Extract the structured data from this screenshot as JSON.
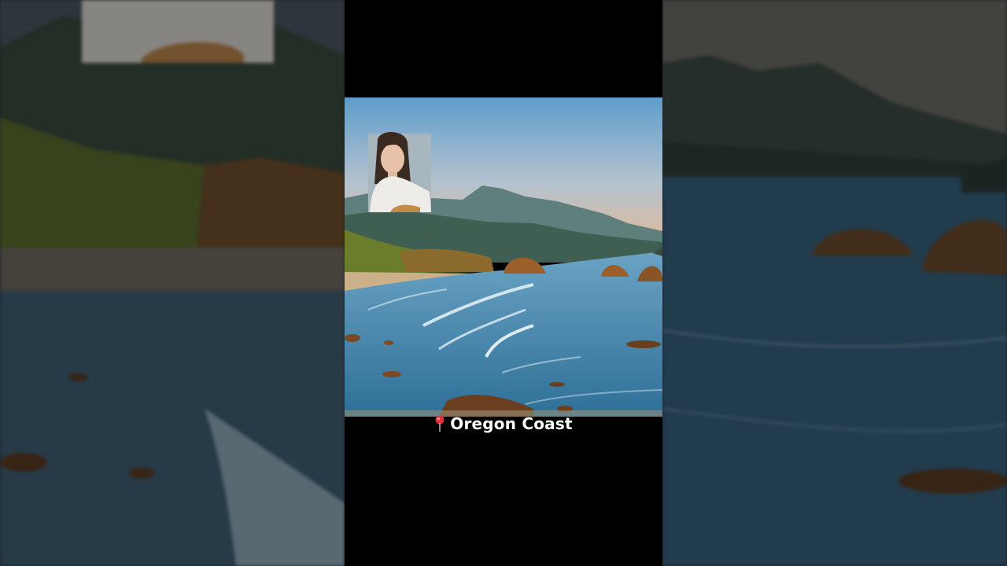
{
  "caption": {
    "icon": "map-pin-icon",
    "text": "Oregon Coast"
  },
  "colors": {
    "sky_top": "#5f9ccb",
    "sky_bottom": "#e6b792",
    "ocean": "#3f86ad",
    "surf": "#dfeef4",
    "cliff": "#8a7a2e",
    "rock": "#9a5f2a",
    "pin": "#e0303a"
  }
}
